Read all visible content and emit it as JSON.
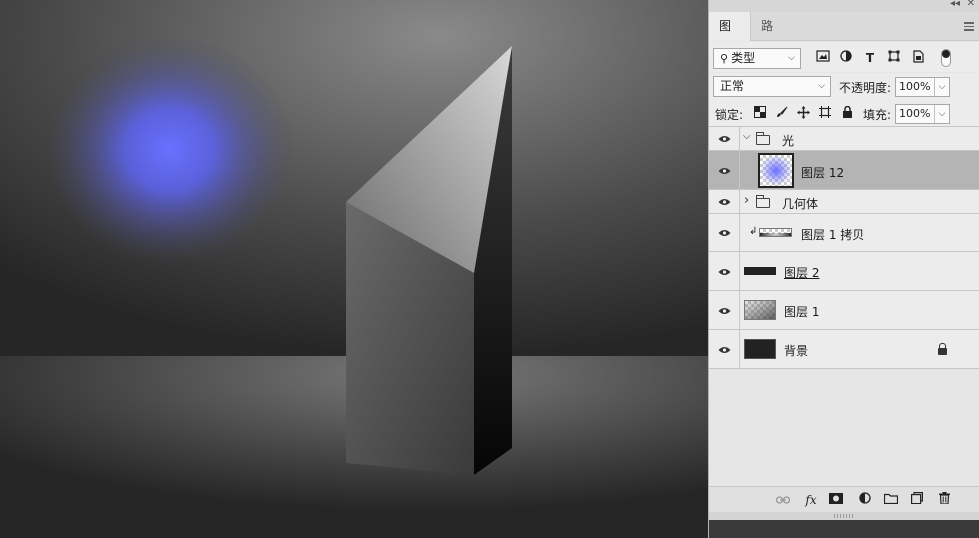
{
  "window": {
    "collapse_icon": "double-chevron-left-icon",
    "close_icon": "close-icon"
  },
  "tabs": [
    {
      "label": "图层",
      "active": true
    },
    {
      "label": "路径",
      "active": false
    }
  ],
  "filter": {
    "kind_label": "类型",
    "icons": [
      "image-filter-icon",
      "adjustment-filter-icon",
      "type-filter-icon",
      "shape-filter-icon",
      "smart-object-filter-icon"
    ]
  },
  "blend": {
    "mode": "正常",
    "opacity_label": "不透明度:",
    "opacity_value": "100%"
  },
  "lock": {
    "label": "锁定:",
    "fill_label": "填充:",
    "fill_value": "100%"
  },
  "layers": [
    {
      "name": "光",
      "kind": "group",
      "expanded": true
    },
    {
      "name": "图层 12",
      "kind": "layer",
      "selected": true
    },
    {
      "name": "几何体",
      "kind": "group",
      "expanded": false
    },
    {
      "name": "图层 1 拷贝",
      "kind": "clipped-layer"
    },
    {
      "name": "图层 2",
      "kind": "layer"
    },
    {
      "name": "图层 1",
      "kind": "layer"
    },
    {
      "name": "背景",
      "kind": "background",
      "locked": true
    }
  ],
  "bottom_icons": [
    "link-layers-icon",
    "fx-icon",
    "add-mask-icon",
    "adjustment-layer-icon",
    "new-group-icon",
    "new-layer-icon",
    "trash-icon"
  ],
  "glyphs": {
    "collapse": "◂◂",
    "close": "✕",
    "caret": "⌵",
    "search": "⚲",
    "twisty_open": "⌵",
    "twisty_closed": "›",
    "clip": "↲",
    "fx": "fx",
    "link": "⊖",
    "mask": "◙",
    "adjust": "◐",
    "trash": "🗑"
  },
  "colors": {
    "light_glow": "#6a70ff",
    "panel_bg": "#ececec",
    "selected_row": "#b4b4b4"
  }
}
